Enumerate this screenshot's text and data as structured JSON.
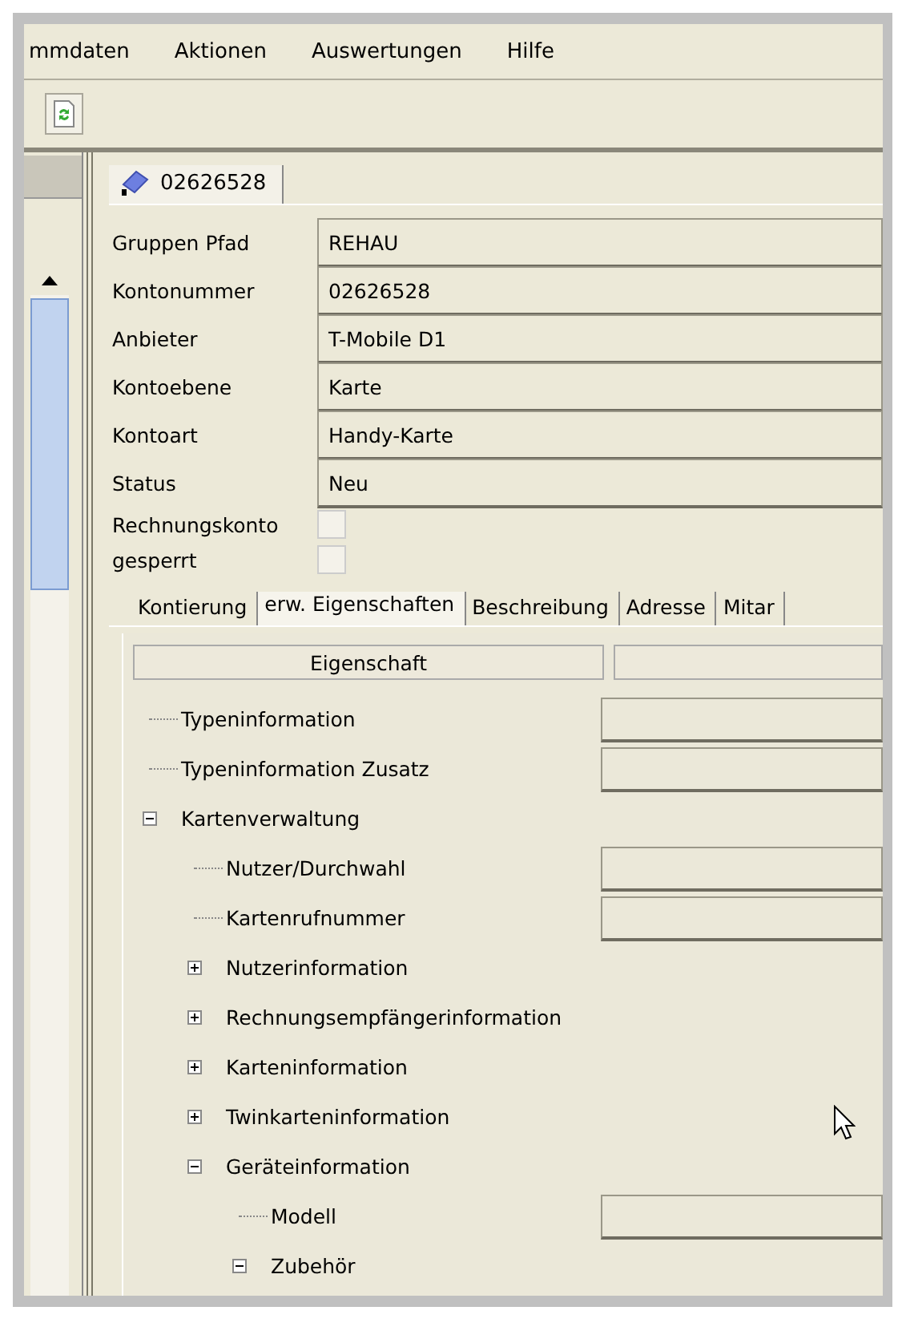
{
  "menu": [
    {
      "label": "mmdaten"
    },
    {
      "label": "Aktionen"
    },
    {
      "label": "Auswertungen"
    },
    {
      "label": "Hilfe"
    }
  ],
  "document_tabs": [
    {
      "label": "02626528",
      "selected": true
    }
  ],
  "fields": [
    {
      "label": "Gruppen Pfad",
      "value": "REHAU"
    },
    {
      "label": "Kontonummer",
      "value": "02626528"
    },
    {
      "label": "Anbieter",
      "value": "T-Mobile D1"
    },
    {
      "label": "Kontoebene",
      "value": "Karte"
    },
    {
      "label": "Kontoart",
      "value": "Handy-Karte"
    },
    {
      "label": "Status",
      "value": "Neu"
    }
  ],
  "checkboxes": [
    {
      "label": "Rechnungskonto",
      "checked": false
    },
    {
      "label": "gesperrt",
      "checked": false
    }
  ],
  "tabs": [
    {
      "label": "Kontierung",
      "selected": false
    },
    {
      "label": "erw. Eigenschaften",
      "selected": true
    },
    {
      "label": "Beschreibung",
      "selected": false
    },
    {
      "label": "Adresse",
      "selected": false
    },
    {
      "label": "Mitar",
      "selected": false
    }
  ],
  "table": {
    "columns": [
      {
        "label": "Eigenschaft"
      }
    ]
  },
  "tree": [
    {
      "label": "Typeninformation",
      "kind": "leaf"
    },
    {
      "label": "Typeninformation Zusatz",
      "kind": "leaf"
    },
    {
      "label": "Kartenverwaltung",
      "kind": "group",
      "expanded": true,
      "children": [
        {
          "label": "Nutzer/Durchwahl",
          "kind": "leaf"
        },
        {
          "label": "Kartenrufnummer",
          "kind": "leaf"
        },
        {
          "label": "Nutzerinformation",
          "kind": "group",
          "expanded": false
        },
        {
          "label": "Rechnungsempfängerinformation",
          "kind": "group",
          "expanded": false
        },
        {
          "label": "Karteninformation",
          "kind": "group",
          "expanded": false
        },
        {
          "label": "Twinkarteninformation",
          "kind": "group",
          "expanded": false
        },
        {
          "label": "Geräteinformation",
          "kind": "group",
          "expanded": true,
          "children": [
            {
              "label": "Modell",
              "kind": "leaf"
            },
            {
              "label": "Zubehör",
              "kind": "group",
              "expanded": true
            }
          ]
        }
      ]
    }
  ]
}
